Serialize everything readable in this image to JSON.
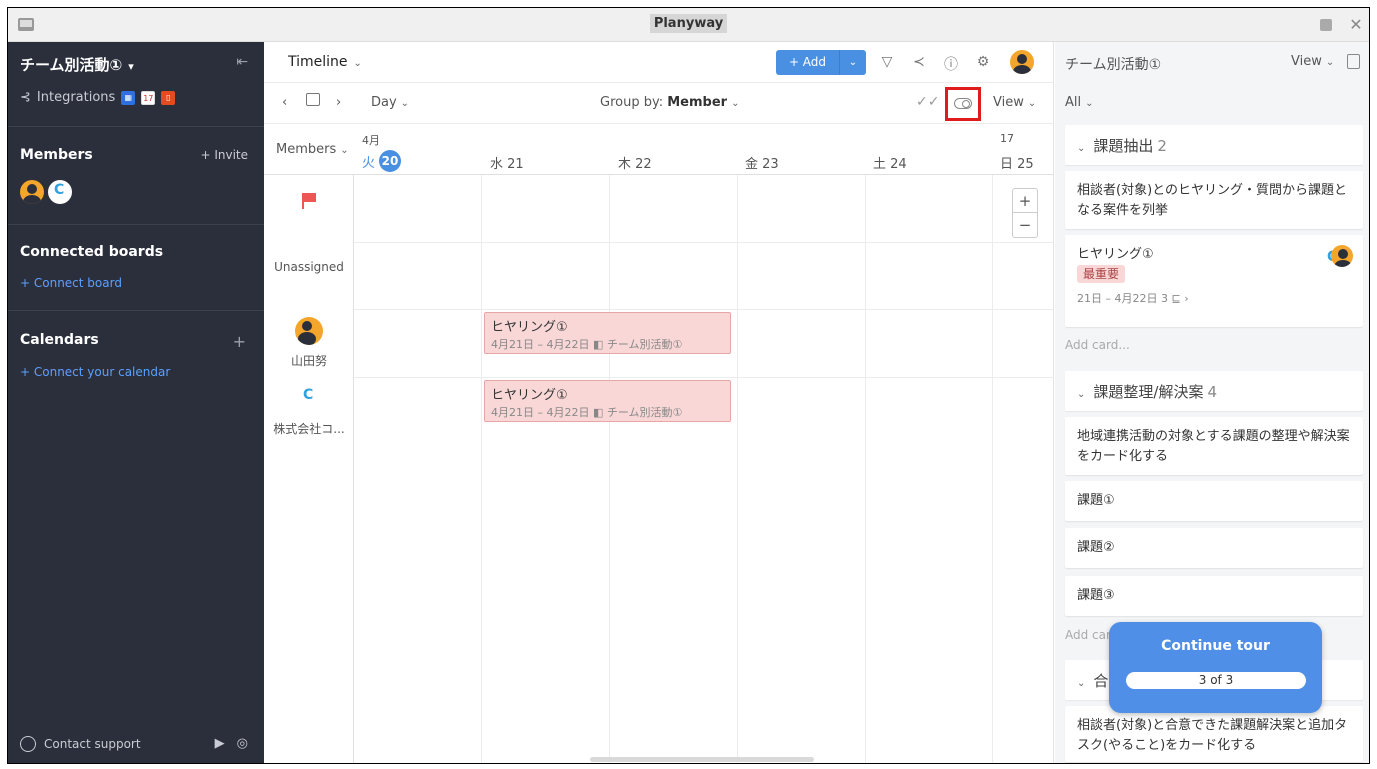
{
  "window": {
    "title": "Planyway"
  },
  "sidebar": {
    "board_name": "チーム別活動①",
    "integrations_label": "Integrations",
    "members_title": "Members",
    "invite_label": "+ Invite",
    "connected_boards_title": "Connected boards",
    "connect_board_label": "+ Connect board",
    "calendars_title": "Calendars",
    "connect_calendar_label": "+ Connect your calendar",
    "contact_support_label": "Contact support"
  },
  "toolbar": {
    "view_name": "Timeline",
    "add_label": "+ Add",
    "zoom": "Day",
    "group_by_label": "Group by:",
    "group_by_value": "Member",
    "view_label": "View"
  },
  "timeline": {
    "members_header": "Members",
    "month": "4月",
    "week_number": "17",
    "today": {
      "weekday": "火",
      "day": "20"
    },
    "days": [
      "水 21",
      "木 22",
      "金 23",
      "土 24",
      "日 25"
    ],
    "rows": [
      {
        "label": ""
      },
      {
        "label": "Unassigned"
      },
      {
        "label": "山田努"
      },
      {
        "label": "株式会社コ..."
      }
    ],
    "tasks": [
      {
        "title": "ヒヤリング①",
        "meta": "4月21日 – 4月22日  ◧ チーム別活動①"
      },
      {
        "title": "ヒヤリング①",
        "meta": "4月21日 – 4月22日  ◧ チーム別活動①"
      }
    ]
  },
  "panel": {
    "title": "チーム別活動①",
    "view_label": "View",
    "filter": "All",
    "lists": [
      {
        "name": "課題抽出",
        "count": "2",
        "cards": [
          {
            "text": "相談者(対象)とのヒヤリング・質問から課題となる案件を列挙"
          },
          {
            "text": "ヒヤリング①",
            "badge": "最重要",
            "meta": "21日 – 4月22日   3 ⊑ ›"
          }
        ],
        "add_card": "Add card..."
      },
      {
        "name": "課題整理/解決案",
        "count": "4",
        "cards": [
          {
            "text": "地域連携活動の対象とする課題の整理や解決案をカード化する"
          },
          {
            "text": "課題①"
          },
          {
            "text": "課題②"
          },
          {
            "text": "課題③"
          }
        ],
        "add_card": "Add card"
      },
      {
        "name": "合",
        "cards": [
          {
            "text": "相談者(対象)と合意できた課題解決案と追加タスク(やること)をカード化する"
          }
        ]
      }
    ]
  },
  "tour": {
    "title": "Continue tour",
    "progress": "3 of 3"
  }
}
